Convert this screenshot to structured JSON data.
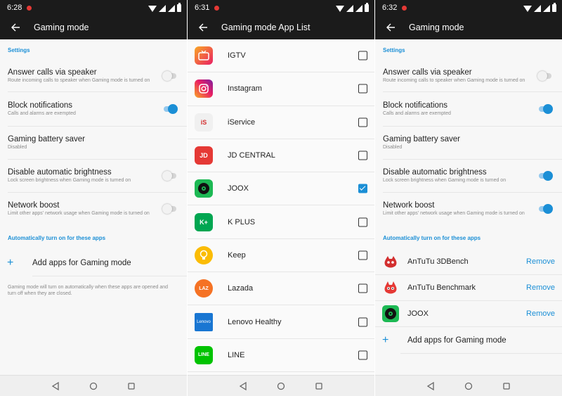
{
  "colors": {
    "accent": "#1b8fd6",
    "bar": "#1b1b1b",
    "subtext": "#8a8a8a"
  },
  "screen1": {
    "status": {
      "time": "6:28"
    },
    "title": "Gaming mode",
    "settings_header": "Settings",
    "settings": [
      {
        "title": "Answer calls via speaker",
        "subtitle": "Route incoming calls to speaker when Gaming mode is turned on",
        "toggle": "off"
      },
      {
        "title": "Block notifications",
        "subtitle": "Calls and alarms are exempted",
        "toggle": "on"
      },
      {
        "title": "Gaming battery saver",
        "subtitle": "Disabled",
        "toggle": "none"
      },
      {
        "title": "Disable automatic brightness",
        "subtitle": "Lock screen brightness when Gaming mode is turned on",
        "toggle": "off"
      },
      {
        "title": "Network boost",
        "subtitle": "Limit other apps' network usage when Gaming mode is turned on",
        "toggle": "off"
      }
    ],
    "auto_header": "Automatically turn on for these apps",
    "add_label": "Add apps for Gaming mode",
    "add_symbol": "+",
    "note": "Gaming mode will turn on automatically when these apps are opened and turn off when they are closed."
  },
  "screen2": {
    "status": {
      "time": "6:31"
    },
    "title": "Gaming mode App List",
    "apps": [
      {
        "name": "IGTV",
        "checked": false,
        "icon": "igtv-icon"
      },
      {
        "name": "Instagram",
        "checked": false,
        "icon": "instagram-icon"
      },
      {
        "name": "iService",
        "checked": false,
        "icon": "iservice-icon"
      },
      {
        "name": "JD CENTRAL",
        "checked": false,
        "icon": "jd-central-icon"
      },
      {
        "name": "JOOX",
        "checked": true,
        "icon": "joox-icon"
      },
      {
        "name": "K PLUS",
        "checked": false,
        "icon": "k-plus-icon"
      },
      {
        "name": "Keep",
        "checked": false,
        "icon": "keep-icon"
      },
      {
        "name": "Lazada",
        "checked": false,
        "icon": "lazada-icon"
      },
      {
        "name": "Lenovo Healthy",
        "checked": false,
        "icon": "lenovo-healthy-icon"
      },
      {
        "name": "LINE",
        "checked": false,
        "icon": "line-icon"
      }
    ]
  },
  "screen3": {
    "status": {
      "time": "6:32"
    },
    "title": "Gaming mode",
    "settings_header": "Settings",
    "settings": [
      {
        "title": "Answer calls via speaker",
        "subtitle": "Route incoming calls to speaker when Gaming mode is turned on",
        "toggle": "off"
      },
      {
        "title": "Block notifications",
        "subtitle": "Calls and alarms are exempted",
        "toggle": "on"
      },
      {
        "title": "Gaming battery saver",
        "subtitle": "Disabled",
        "toggle": "none"
      },
      {
        "title": "Disable automatic brightness",
        "subtitle": "Lock screen brightness when Gaming mode is turned on",
        "toggle": "on"
      },
      {
        "title": "Network boost",
        "subtitle": "Limit other apps' network usage when Gaming mode is turned on",
        "toggle": "on"
      }
    ],
    "auto_header": "Automatically turn on for these apps",
    "games": [
      {
        "name": "AnTuTu 3DBench",
        "action": "Remove",
        "icon": "antutu-3dbench-icon"
      },
      {
        "name": "AnTuTu Benchmark",
        "action": "Remove",
        "icon": "antutu-benchmark-icon"
      },
      {
        "name": "JOOX",
        "action": "Remove",
        "icon": "joox-icon"
      }
    ],
    "add_label": "Add apps for Gaming mode",
    "add_symbol": "+"
  },
  "icons": {
    "back": "arrow-back-icon",
    "nav_back": "triangle-back-icon",
    "nav_home": "circle-home-icon",
    "nav_recents": "square-recents-icon",
    "plus": "plus-icon"
  },
  "brand_glyphs": {
    "iservice": "iS",
    "jd": "JD",
    "kplus": "K+",
    "lazada": "LAZ",
    "lenovo": "Lenovo",
    "line": "LINE"
  }
}
